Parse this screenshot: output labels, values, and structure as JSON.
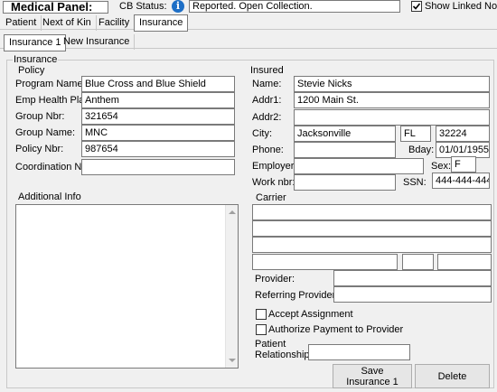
{
  "header": {
    "panel_title": "Medical Panel:",
    "cb_status_label": "CB Status:",
    "status_text": "Reported. Open Collection.",
    "show_linked_notes_label": "Show Linked Notes",
    "show_linked_notes_checked": true
  },
  "main_tabs": [
    "Patient",
    "Next of Kin",
    "Facility",
    "Insurance"
  ],
  "main_tab_selected": "Insurance",
  "sub_tabs": [
    "Insurance 1",
    "New Insurance"
  ],
  "sub_tab_selected": "Insurance 1",
  "insurance_group_label": "Insurance",
  "policy": {
    "section_label": "Policy",
    "program_name_label": "Program Name:",
    "program_name": "Blue Cross and Blue Shield",
    "emp_health_plan_label": "Emp Health Plan:",
    "emp_health_plan": "Anthem",
    "group_nbr_label": "Group Nbr:",
    "group_nbr": "321654",
    "group_name_label": "Group Name:",
    "group_name": "MNC",
    "policy_nbr_label": "Policy Nbr:",
    "policy_nbr": "987654",
    "coordination_nbr_label": "Coordination Nbr:",
    "coordination_nbr": "",
    "additional_info_label": "Additional Info",
    "additional_info": ""
  },
  "insured": {
    "section_label": "Insured",
    "name_label": "Name:",
    "name": "Stevie Nicks",
    "addr1_label": "Addr1:",
    "addr1": "1200 Main St.",
    "addr2_label": "Addr2:",
    "addr2": "",
    "city_label": "City:",
    "city": "Jacksonville",
    "state": "FL",
    "zip": "32224",
    "phone_label": "Phone:",
    "phone": "",
    "bday_label": "Bday:",
    "bday": "01/01/1955",
    "employer_label": "Employer:",
    "employer": "",
    "sex_label": "Sex:",
    "sex": "F",
    "work_nbr_label": "Work nbr:",
    "work_nbr": "",
    "ssn_label": "SSN:",
    "ssn": "444-444-4444"
  },
  "carrier": {
    "section_label": "Carrier",
    "line1": "",
    "line2": "",
    "line3": "",
    "city": "",
    "state": "",
    "zip": "",
    "provider_label": "Provider:",
    "provider": "",
    "referring_provider_label": "Referring Provider:",
    "referring_provider": "",
    "accept_assignment_label": "Accept Assignment",
    "accept_assignment_checked": false,
    "authorize_payment_label": "Authorize Payment to Provider",
    "authorize_payment_checked": false,
    "patient_relationship_label_1": "Patient",
    "patient_relationship_label_2": "Relationship:",
    "patient_relationship": ""
  },
  "buttons": {
    "save_line1": "Save",
    "save_line2": "Insurance 1",
    "delete": "Delete"
  },
  "icons": {
    "info": "info-icon",
    "check": "check-icon"
  },
  "colors": {
    "info_icon": "#1e6fc6",
    "selected_tab_bg": "#ffffff"
  }
}
